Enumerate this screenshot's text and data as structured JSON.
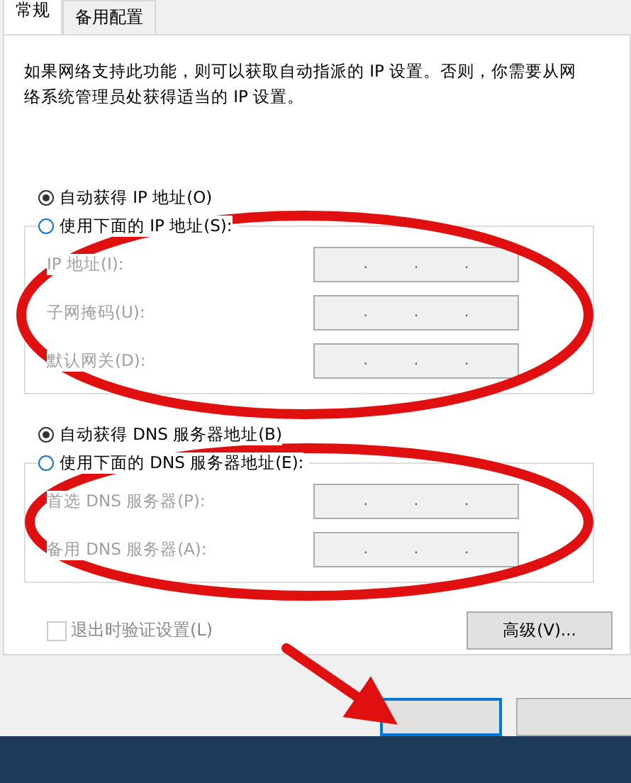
{
  "tabs": [
    {
      "label": "常规",
      "selected": true
    },
    {
      "label": "备用配置",
      "selected": false
    }
  ],
  "description": "如果网络支持此功能，则可以获取自动指派的 IP 设置。否则，你需要从网络系统管理员处获得适当的 IP 设置。",
  "ip_section": {
    "auto_option": {
      "label": "自动获得 IP 地址(O)",
      "selected": true
    },
    "manual_option": {
      "label": "使用下面的 IP 地址(S):",
      "selected": false
    },
    "fields": [
      {
        "label": "IP 地址(I):",
        "disabled": true,
        "separators": [
          ".",
          ".",
          "."
        ]
      },
      {
        "label": "子网掩码(U):",
        "disabled": true,
        "separators": [
          ".",
          ".",
          "."
        ]
      },
      {
        "label": "默认网关(D):",
        "disabled": true,
        "separators": [
          ".",
          ".",
          "."
        ]
      }
    ]
  },
  "dns_section": {
    "auto_option": {
      "label": "自动获得 DNS 服务器地址(B)",
      "selected": true
    },
    "manual_option": {
      "label": "使用下面的 DNS 服务器地址(E):",
      "selected": false
    },
    "fields": [
      {
        "label": "首选 DNS 服务器(P):",
        "disabled": true,
        "separators": [
          ".",
          ".",
          "."
        ]
      },
      {
        "label": "备用 DNS 服务器(A):",
        "disabled": true,
        "separators": [
          ".",
          ".",
          "."
        ]
      }
    ]
  },
  "validate_checkbox": {
    "label": "退出时验证设置(L)",
    "checked": false,
    "disabled": true
  },
  "advanced_button": "高级(V)...",
  "footer_buttons": [
    {
      "kind": "default"
    },
    {
      "kind": "plain"
    }
  ],
  "annotations": [
    {
      "kind": "ellipse"
    },
    {
      "kind": "ellipse"
    },
    {
      "kind": "arrow"
    }
  ]
}
